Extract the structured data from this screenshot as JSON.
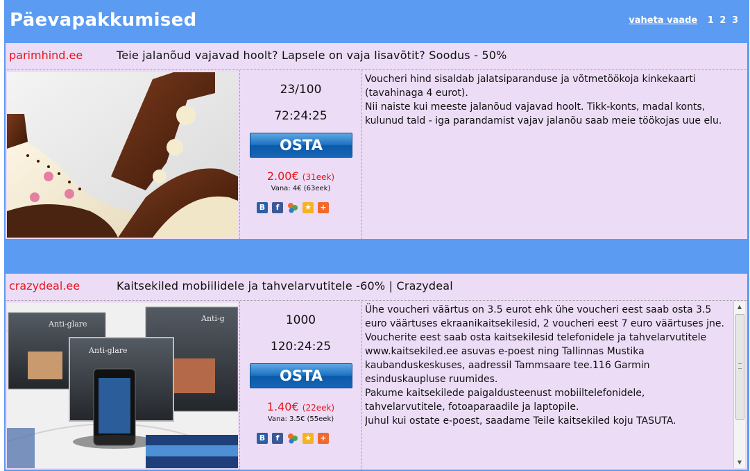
{
  "header": {
    "title": "Päevapakkumised",
    "switch_view": "vaheta vaade",
    "pages": [
      "1",
      "2",
      "3"
    ]
  },
  "deals": [
    {
      "site": "parimhind.ee",
      "headline": "Teie jalanõud vajavad hoolt? Lapsele on vaja lisavõtit? Soodus - 50%",
      "count": "23/100",
      "timer": "72:24:25",
      "buy_label": "OSTA",
      "price": "2.00€",
      "price_eek": "(31eek)",
      "old_price": "Vana: 4€ (63eek)",
      "description": [
        "Voucheri hind sisaldab jalatsiparanduse ja võtmetöökoja kinkekaarti (tavahinaga 4 eurot).",
        "Nii naiste kui meeste jalanõud vajavad hoolt. Tikk-konts, madal konts, kulunud tald - iga parandamist vajav jalanõu saab meie töökojas uue elu."
      ]
    },
    {
      "site": "crazydeal.ee",
      "headline": "Kaitsekiled mobiilidele ja tahvelarvutitele -60% | Crazydeal",
      "count": "1000",
      "timer": "120:24:25",
      "buy_label": "OSTA",
      "price": "1.40€",
      "price_eek": "(22eek)",
      "old_price": "Vana: 3.5€ (55eek)",
      "image_text_1": "Anti-glare",
      "image_text_2": "Anti-g",
      "image_text_3": "Anti-glare",
      "description": [
        "Ühe voucheri väärtus on 3.5 eurot ehk ühe voucheri eest saab osta 3.5 euro väärtuses ekraanikaitsekilesid, 2 voucheri eest 7 euro väärtuses jne.",
        "Voucherite eest saab osta kaitsekilesid telefonidele ja tahvelarvutitele www.kaitsekiled.ee asuvas e-poest ning Tallinnas Mustika kaubanduskeskuses, aadressil Tammsaare tee.116 Garmin esinduskaupluse ruumides.",
        "Pakume kaitsekilede paigaldusteenust mobiiltelefonidele, tahvelarvutitele, fotoaparaadile ja laptopile.",
        "Juhul kui ostate e-poest, saadame Teile kaitsekiled koju TASUTA."
      ]
    }
  ],
  "share_icons": [
    "blogger-icon",
    "facebook-icon",
    "delicious-icon",
    "favorite-star-icon",
    "add-plus-icon"
  ],
  "colors": {
    "header_bg": "#5b9bf2",
    "deal_bg": "#ecdcf5",
    "site_red": "#e8141a",
    "buy_blue": "#1c72c2"
  }
}
